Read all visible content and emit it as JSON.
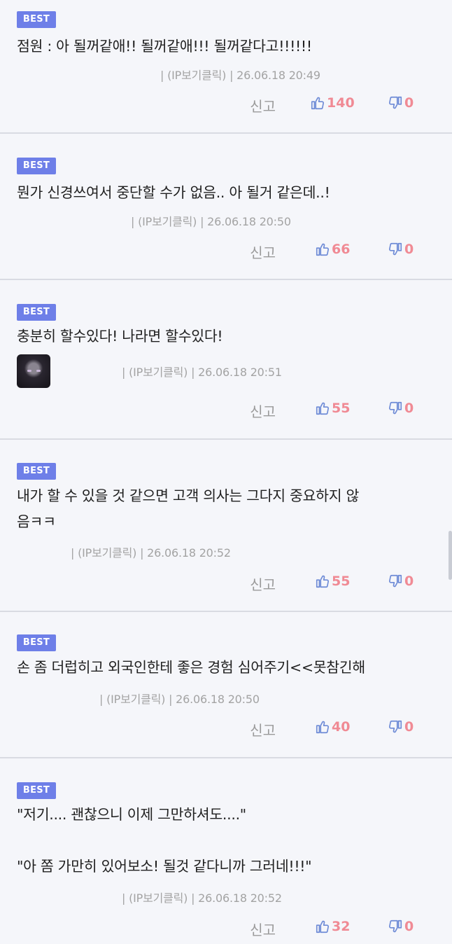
{
  "colors": {
    "badge": "#6e7fe8",
    "like_icon": "#6e8bd6",
    "count": "#f08a94",
    "divider": "#d9dbe2"
  },
  "comments": [
    {
      "badge": "BEST",
      "text": "점원 : 아 될꺼같애!! 될꺼같애!!! 될꺼같다고!!!!!!",
      "meta": "| (IP보기클릭) | 26.06.18 20:49",
      "report": "신고",
      "likes": "140",
      "dislikes": "0",
      "has_avatar": false
    },
    {
      "badge": "BEST",
      "text": "뭔가 신경쓰여서 중단할 수가 없음.. 아 될거 같은데..!",
      "meta": "| (IP보기클릭) | 26.06.18 20:50",
      "report": "신고",
      "likes": "66",
      "dislikes": "0",
      "has_avatar": false
    },
    {
      "badge": "BEST",
      "text": "충분히 할수있다! 나라면 할수있다!",
      "meta": "| (IP보기클릭) | 26.06.18 20:51",
      "report": "신고",
      "likes": "55",
      "dislikes": "0",
      "has_avatar": true
    },
    {
      "badge": "BEST",
      "text": "내가 할 수 있을 것 같으면 고객 의사는 그다지 중요하지 않\n음ㅋㅋ",
      "meta": "| (IP보기클릭) | 26.06.18 20:52",
      "report": "신고",
      "likes": "55",
      "dislikes": "0",
      "has_avatar": false
    },
    {
      "badge": "BEST",
      "text": "손 좀 더럽히고 외국인한테 좋은 경험 심어주기<<못참긴해",
      "meta": "| (IP보기클릭) | 26.06.18 20:50",
      "report": "신고",
      "likes": "40",
      "dislikes": "0",
      "has_avatar": false
    },
    {
      "badge": "BEST",
      "text": "\"저기.... 괜찮으니 이제 그만하셔도....\"\n\n\"아 쫌 가만히 있어보소! 될것 같다니까 그러네!!!\"",
      "meta": "| (IP보기클릭) | 26.06.18 20:52",
      "report": "신고",
      "likes": "32",
      "dislikes": "0",
      "has_avatar": false
    }
  ]
}
